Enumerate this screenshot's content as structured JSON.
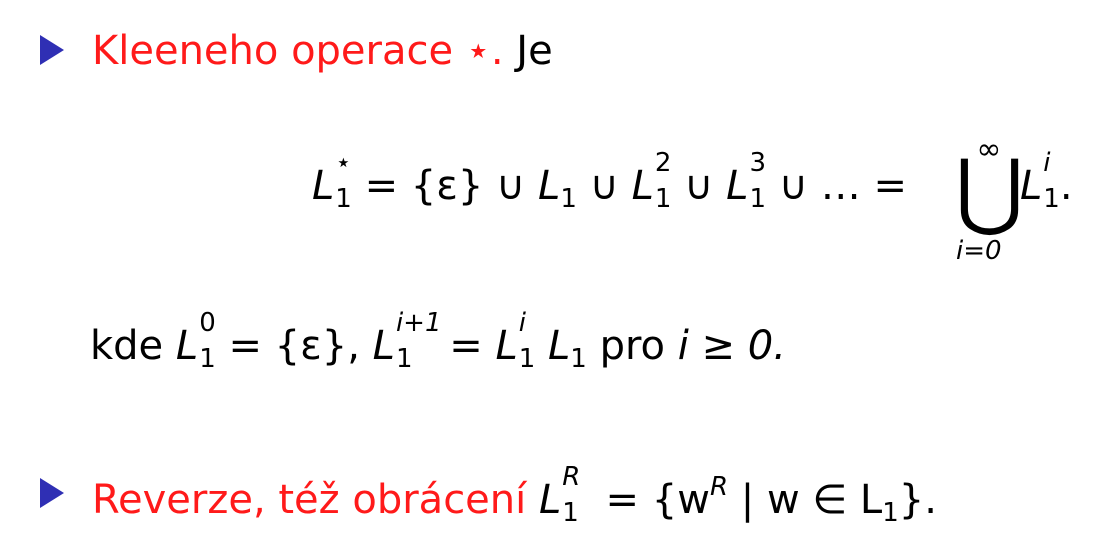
{
  "items": [
    {
      "title": "Kleeneho operace ⋆.",
      "tail": "Je",
      "formula": {
        "lhs_base": "L",
        "lhs_sup": "⋆",
        "lhs_sub": "1",
        "eq": "=",
        "set_eps": "{ε}",
        "cup": "∪",
        "t1": "L",
        "t1_sub": "1",
        "t2": "L",
        "t2_sup": "2",
        "t2_sub": "1",
        "t3": "L",
        "t3_sup": "3",
        "t3_sub": "1",
        "dots": "…",
        "eq2": "=",
        "bigcup": "⋃",
        "bigcup_top": "∞",
        "bigcup_bottom": "i=0",
        "final": "L",
        "final_sup": "i",
        "final_sub": "1",
        "period": "."
      },
      "where": {
        "kde": "kde",
        "L0": "L",
        "L0_sup": "0",
        "L0_sub": "1",
        "eq_eps": "= {ε},",
        "Li1": "L",
        "Li1_sup": "i+1",
        "Li1_sub": "1",
        "eq": "=",
        "Li": "L",
        "Li_sup": "i",
        "Li_sub": "1",
        "L1": "L",
        "L1_sub": "1",
        "pro": "pro",
        "cond": "i ≥ 0."
      }
    },
    {
      "title": "Reverze, též obrácení",
      "formula": {
        "L": "L",
        "L_sup": "R",
        "L_sub": "1",
        "rest": "= {w",
        "w_sup": "R",
        "mid": " | w ∈ L",
        "mid_sub": "1",
        "end": "}."
      }
    }
  ]
}
